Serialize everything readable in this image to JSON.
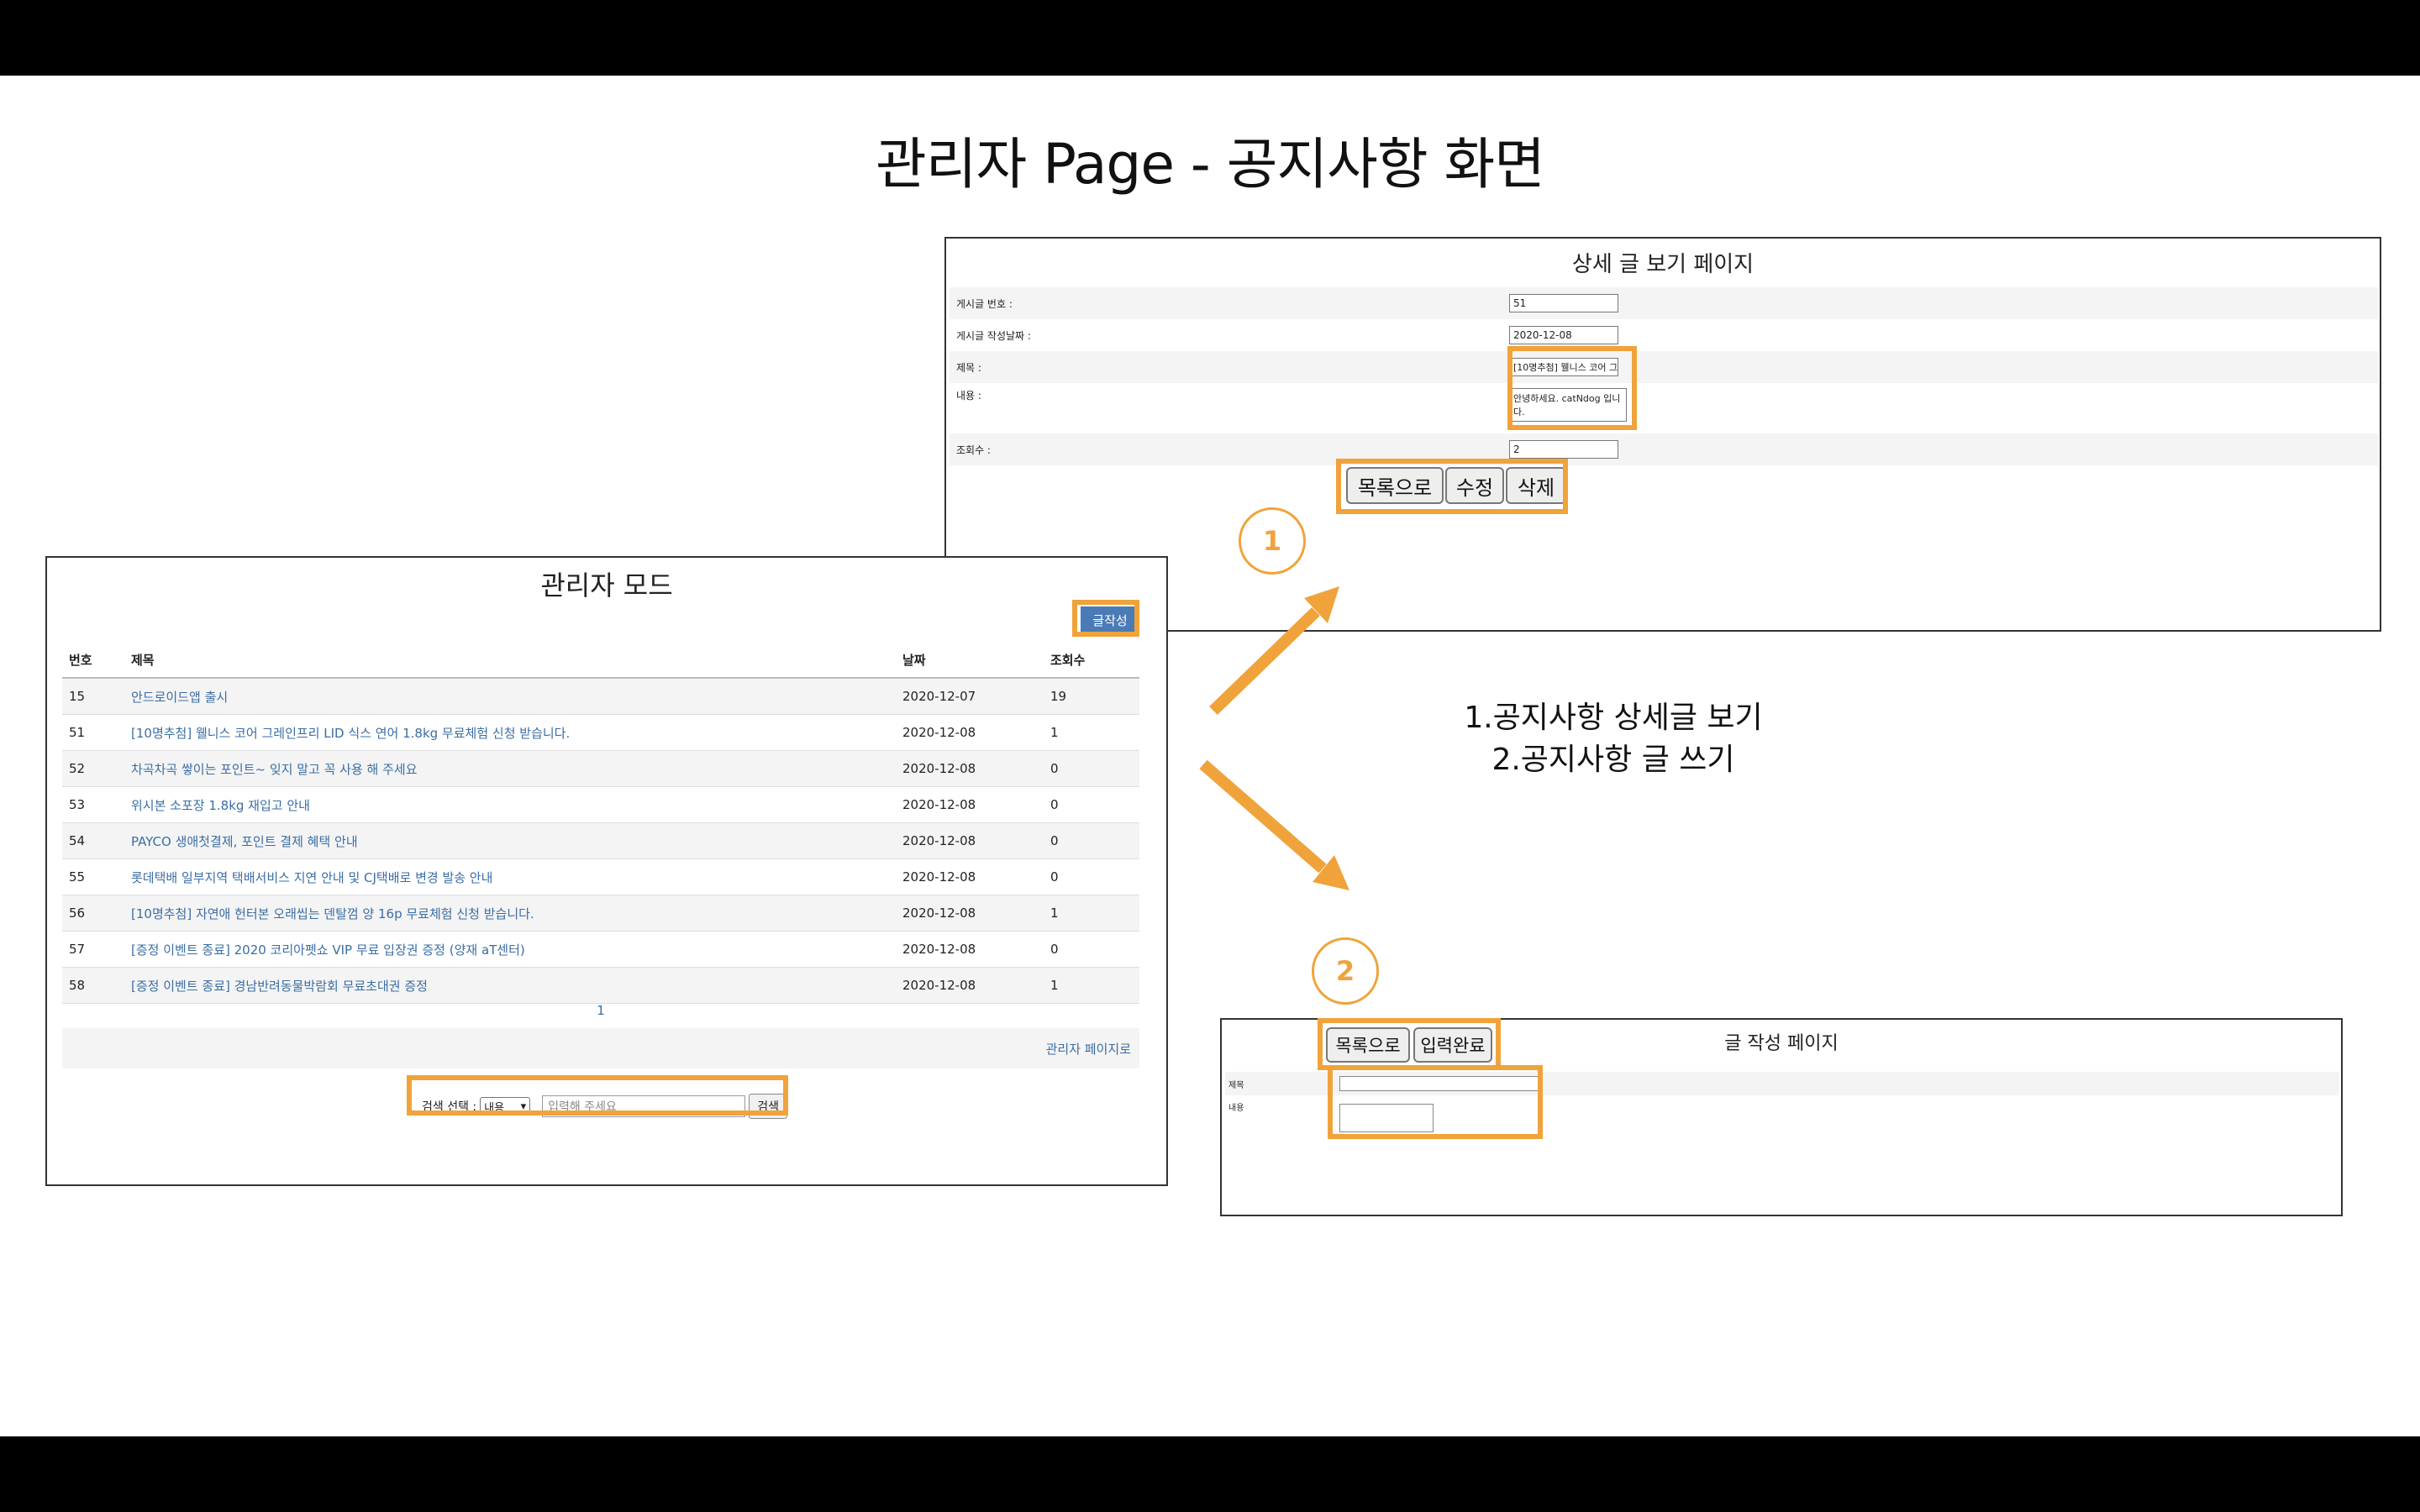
{
  "slide_title": "관리자 Page - 공지사항 화면",
  "accent_color": "#f0a33a",
  "list_window": {
    "title": "관리자 모드",
    "write_button": "글작성",
    "columns": [
      "번호",
      "제목",
      "날짜",
      "조회수"
    ],
    "rows": [
      {
        "no": "15",
        "title": "안드로이드앱 출시",
        "date": "2020-12-07",
        "views": "19"
      },
      {
        "no": "51",
        "title": "[10명추첨] 웰니스 코어 그레인프리 LID 식스 연어 1.8kg 무료체험 신청 받습니다.",
        "date": "2020-12-08",
        "views": "1"
      },
      {
        "no": "52",
        "title": "차곡차곡 쌓이는 포인트~ 잊지 말고 꼭 사용 해 주세요",
        "date": "2020-12-08",
        "views": "0"
      },
      {
        "no": "53",
        "title": "위시본 소포장 1.8kg 재입고 안내",
        "date": "2020-12-08",
        "views": "0"
      },
      {
        "no": "54",
        "title": "PAYCO 생애첫결제, 포인트 결제 혜택 안내",
        "date": "2020-12-08",
        "views": "0"
      },
      {
        "no": "55",
        "title": "롯데택배 일부지역 택배서비스 지연 안내 및 CJ택배로 변경 발송 안내",
        "date": "2020-12-08",
        "views": "0"
      },
      {
        "no": "56",
        "title": "[10명추첨] 자연애 헌터본 오래씹는 덴탈껌 양 16p 무료체험 신청 받습니다.",
        "date": "2020-12-08",
        "views": "1"
      },
      {
        "no": "57",
        "title": "[증정 이벤트 종료] 2020 코리아펫쇼 VIP 무료 입장권 증정 (양재 aT센터)",
        "date": "2020-12-08",
        "views": "0"
      },
      {
        "no": "58",
        "title": "[증정 이벤트 종료] 경남반려동물박람회 무료초대권 증정",
        "date": "2020-12-08",
        "views": "1"
      }
    ],
    "page": "1",
    "admin_link": "관리자 페이지로",
    "search_label": "검색 선택 :",
    "search_select": "내용",
    "search_placeholder": "입력해 주세요",
    "search_button": "검색"
  },
  "detail_window": {
    "title": "상세 글 보기 페이지",
    "fields": [
      {
        "label": "게시글 번호 :",
        "value": "51"
      },
      {
        "label": "게시글 작성날짜 :",
        "value": "2020-12-08"
      },
      {
        "label": "제목 :",
        "value": "[10명추첨] 웰니스 코어 그"
      },
      {
        "label": "내용 :",
        "value": "안녕하세요. catNdog 입니다."
      },
      {
        "label": "조회수 :",
        "value": "2"
      }
    ],
    "buttons": {
      "list": "목록으로",
      "edit": "수정",
      "delete": "삭제"
    }
  },
  "write_window": {
    "title": "글 작성 페이지",
    "fields": [
      {
        "label": "제목",
        "value": ""
      },
      {
        "label": "내용",
        "value": ""
      }
    ],
    "buttons": {
      "list": "목록으로",
      "submit": "입력완료"
    }
  },
  "steps": {
    "one": "1",
    "two": "2"
  },
  "notes": [
    "1.공지사항 상세글 보기",
    "2.공지사항 글 쓰기"
  ]
}
